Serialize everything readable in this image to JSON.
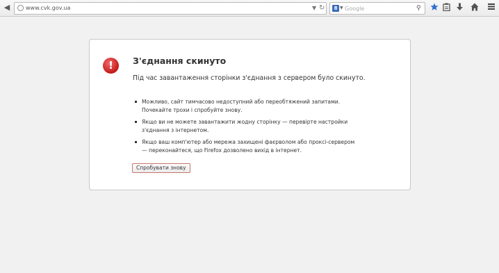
{
  "toolbar": {
    "url": "www.cvk.gov.ua",
    "search_placeholder": "Google",
    "search_engine_letter": "8"
  },
  "icons": {
    "back": "back-arrow-icon",
    "site": "globe-icon",
    "dropdown": "chevron-down-icon",
    "reload": "reload-icon",
    "search": "magnifier-icon",
    "bookmark": "star-icon",
    "bookmarks_menu": "clipboard-icon",
    "downloads": "download-arrow-icon",
    "home": "home-icon",
    "menu": "hamburger-icon"
  },
  "colors": {
    "accent_star": "#2f6fcf",
    "alert_red": "#d42020",
    "button_border": "#c5766b"
  },
  "error": {
    "title": "З'єднання скинуто",
    "description": "Під час завантаження сторінки з'єднання з сервером було скинуто.",
    "suggestions": [
      {
        "line1": "Можливо, сайт тимчасово недоступний або переобтяжений запитами.",
        "line2": "Почекайте трохи і спробуйте знову."
      },
      {
        "line1": "Якщо ви не можете завантажити жодну сторінку — перевірте настройки",
        "line2": "з'єднання з інтернетом."
      },
      {
        "line1": "Якщо ваш комп'ютер або мережа захищені фаєрволом або проксі-сервером",
        "line2": "— переконайтеся, що Firefox дозволено вихід в інтернет."
      }
    ],
    "retry_label": "Спробувати знову"
  }
}
